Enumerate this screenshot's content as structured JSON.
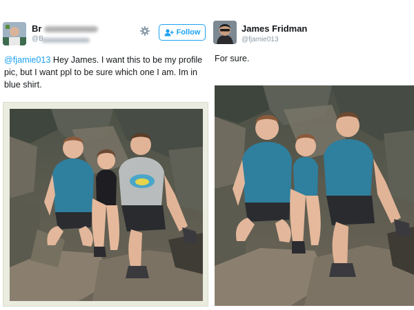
{
  "left_tweet": {
    "author_name_visible": "Br",
    "author_handle_visible": "@B",
    "follow_label": "Follow",
    "mention": "@fjamie013",
    "text": " Hey James. I want this to be my profile pic, but I want ppl to be sure which one I am. Im in blue shirt.",
    "avatar": "avatar-photo",
    "settings_icon": "gear-icon",
    "follow_icon": "add-user-icon"
  },
  "right_tweet": {
    "author_name": "James Fridman",
    "author_handle": "@fjamie013",
    "text": "For sure.",
    "avatar": "avatar-photo"
  },
  "colors": {
    "twitter_blue": "#1da1f2",
    "text": "#14171a",
    "muted": "#8899a6",
    "shirt_blue": "#2f7f9e",
    "shirt_gray": "#b8bcbd",
    "rock": "#6f6a5c",
    "frame": "#e9ecdf"
  }
}
